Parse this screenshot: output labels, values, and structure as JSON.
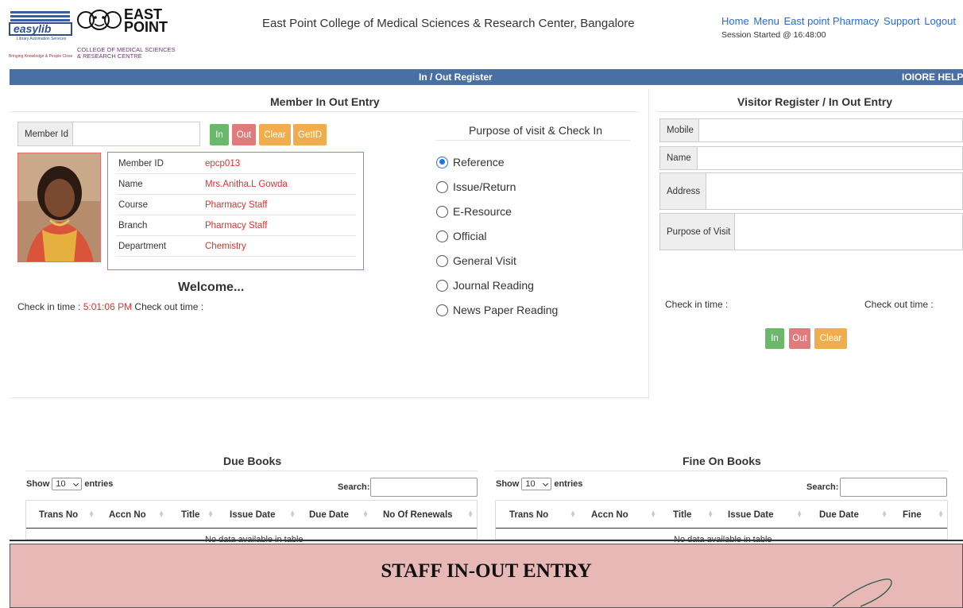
{
  "header": {
    "easylib_logo_text": "easylib",
    "easylib_sub": "Library Automation Services",
    "easylib_tagline": "Bringing Knowledge & People Close",
    "eastpoint_name_line1": "EAST",
    "eastpoint_name_line2": "POINT",
    "eastpoint_college_line1": "COLLEGE OF MEDICAL SCIENCES",
    "eastpoint_college_line2": "& RESEARCH CENTRE",
    "college_title": "East Point College of Medical Sciences & Research Center, Bangalore",
    "nav": [
      "Home",
      "Menu",
      "East point Pharmacy",
      "Support",
      "Logout"
    ],
    "session": "Session Started @ 16:48:00"
  },
  "bluebar": {
    "title": "In / Out Register",
    "right": "IOIORE HELP"
  },
  "member": {
    "section_title": "Member In Out Entry",
    "member_id_label": "Member Id",
    "member_id_value": "",
    "buttons": {
      "in": "In",
      "out": "Out",
      "clear": "Clear",
      "getid": "GetID"
    },
    "info": [
      {
        "label": "Member ID",
        "value": "epcp013"
      },
      {
        "label": "Name",
        "value": "Mrs.Anitha.L Gowda"
      },
      {
        "label": "Course",
        "value": "Pharmacy Staff"
      },
      {
        "label": "Branch",
        "value": "Pharmacy Staff"
      },
      {
        "label": "Department",
        "value": "Chemistry"
      }
    ],
    "welcome": "Welcome...",
    "checkin_label": "Check in time :",
    "checkin_value": "5:01:06 PM",
    "checkout_label": "Check out time :"
  },
  "purpose": {
    "title": "Purpose of visit & Check In",
    "options": [
      "Reference",
      "Issue/Return",
      "E-Resource",
      "Official",
      "General Visit",
      "Journal Reading",
      "News Paper Reading"
    ],
    "selected_index": 0
  },
  "visitor": {
    "section_title": "Visitor Register / In Out Entry",
    "fields": {
      "mobile": "Mobile",
      "name": "Name",
      "address": "Address",
      "purpose": "Purpose of Visit"
    },
    "checkin_label": "Check in time :",
    "checkout_label": "Check out time :",
    "buttons": {
      "in": "In",
      "out": "Out",
      "clear": "Clear"
    }
  },
  "due_books": {
    "title": "Due Books",
    "show_label": "Show",
    "entries_value": "10",
    "entries_label": "entries",
    "search_label": "Search:",
    "columns": [
      "Trans No",
      "Accn No",
      "Title",
      "Issue Date",
      "Due Date",
      "No Of Renewals"
    ],
    "empty_text": "No data available in table"
  },
  "fine_books": {
    "title": "Fine On Books",
    "show_label": "Show",
    "entries_value": "10",
    "entries_label": "entries",
    "search_label": "Search:",
    "columns": [
      "Trans No",
      "Accn No",
      "Title",
      "Issue Date",
      "Due Date",
      "Fine"
    ],
    "empty_text": "No data available in table"
  },
  "banner": {
    "text": "STAFF IN-OUT ENTRY"
  },
  "colors": {
    "primary_blue": "#4a6fa5",
    "red_value": "#e03030",
    "green_border": "#5bb55b",
    "banner_bg": "#e8b8b7"
  }
}
